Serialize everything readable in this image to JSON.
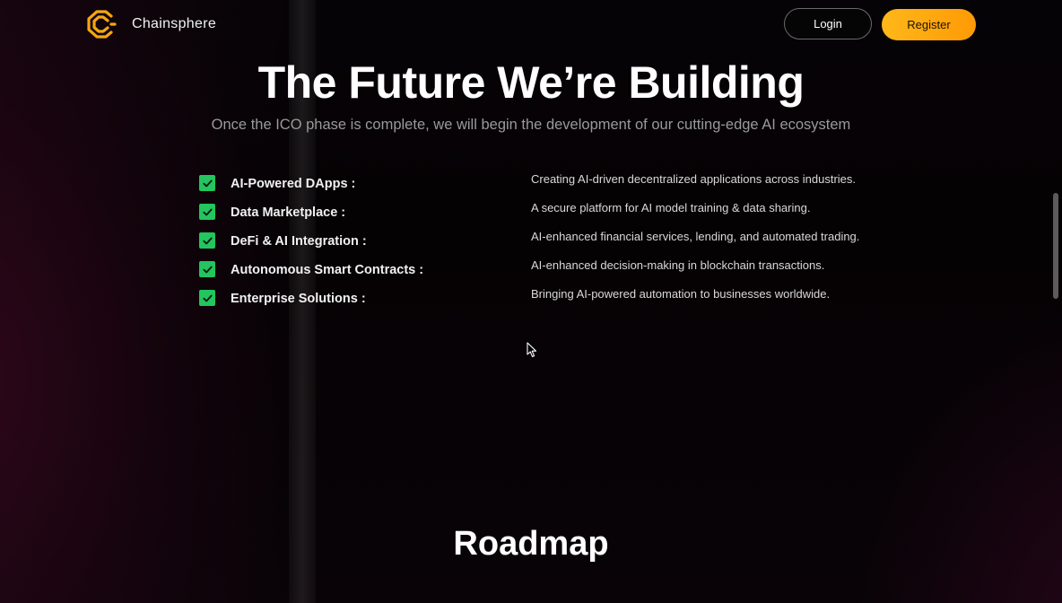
{
  "header": {
    "brand_name": "Chainsphere",
    "login_label": "Login",
    "register_label": "Register"
  },
  "hero": {
    "title": "The Future We’re Building",
    "subtitle": "Once the ICO phase is complete, we will begin the development of our cutting-edge AI ecosystem"
  },
  "features": [
    {
      "name": "AI-Powered DApps :",
      "description": "Creating AI-driven decentralized applications across industries."
    },
    {
      "name": "Data Marketplace :",
      "description": "A secure platform for AI model training & data sharing."
    },
    {
      "name": "DeFi & AI Integration :",
      "description": "AI-enhanced financial services, lending, and automated trading."
    },
    {
      "name": "Autonomous Smart Contracts :",
      "description": "AI-enhanced decision-making in blockchain transactions."
    },
    {
      "name": "Enterprise Solutions :",
      "description": "Bringing AI-powered automation to businesses worldwide."
    }
  ],
  "roadmap": {
    "title": "Roadmap"
  },
  "icons": {
    "logo": "chainsphere-logo-icon",
    "check": "checkbox-checked-icon",
    "cursor": "mouse-pointer-icon"
  },
  "colors": {
    "accent": "#ffa510",
    "check": "#22c55e",
    "background": "#050204"
  }
}
